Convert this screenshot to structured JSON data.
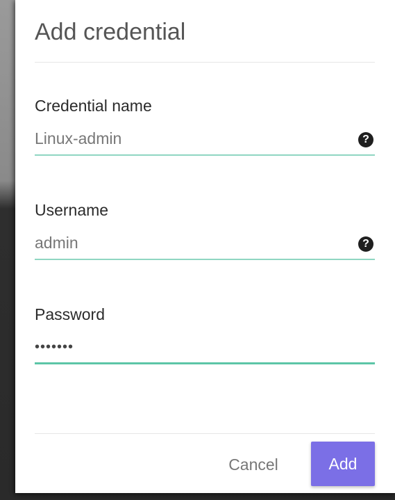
{
  "dialog": {
    "title": "Add credential"
  },
  "fields": {
    "credential_name": {
      "label": "Credential name",
      "value": "Linux-admin",
      "help_icon": "question-circle-icon"
    },
    "username": {
      "label": "Username",
      "value": "admin",
      "help_icon": "question-circle-icon"
    },
    "password": {
      "label": "Password",
      "value": "•••••••"
    }
  },
  "actions": {
    "cancel_label": "Cancel",
    "add_label": "Add"
  },
  "colors": {
    "accent": "#7b6fe6",
    "underline": "#8fd6c2",
    "underline_active": "#5cc5a7"
  }
}
